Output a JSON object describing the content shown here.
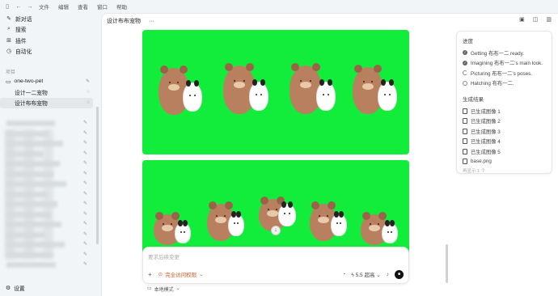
{
  "titlebar": {
    "menu": [
      "文件",
      "编辑",
      "查看",
      "窗口",
      "帮助"
    ]
  },
  "sidebar": {
    "top_items": [
      {
        "label": "新对话",
        "icon": "compose-icon"
      },
      {
        "label": "搜索",
        "icon": "search-icon"
      },
      {
        "label": "插件",
        "icon": "plugin-icon"
      },
      {
        "label": "自动化",
        "icon": "clock-icon"
      }
    ],
    "projects_label": "项目",
    "project": {
      "name": "one-two-pet"
    },
    "threads": [
      {
        "label": "设计一二宠物",
        "status": "spinner"
      },
      {
        "label": "设计布布宠物",
        "status": "spinner",
        "active": true
      }
    ],
    "settings_label": "设置"
  },
  "main": {
    "title": "设计布布宠物",
    "more": "···",
    "composer": {
      "placeholder": "要求后续变更",
      "access_label": "完全访问权限",
      "model": "5.5",
      "effort": "超高"
    },
    "local_mode": "本地模式"
  },
  "progress": {
    "title": "进度",
    "steps": [
      {
        "label": "Getting 布布一二 ready.",
        "state": "done"
      },
      {
        "label": "Imagining 布布一二's main look.",
        "state": "done"
      },
      {
        "label": "Picturing 布布一二's poses.",
        "state": "running"
      },
      {
        "label": "Hatching 布布一二.",
        "state": "pending"
      }
    ],
    "results_title": "生成结果",
    "results": [
      "已生成图像 1",
      "已生成图像 2",
      "已生成图像 3",
      "已生成图像 4",
      "已生成图像 5",
      "base.png"
    ],
    "more_text": "再显示 1 个"
  }
}
